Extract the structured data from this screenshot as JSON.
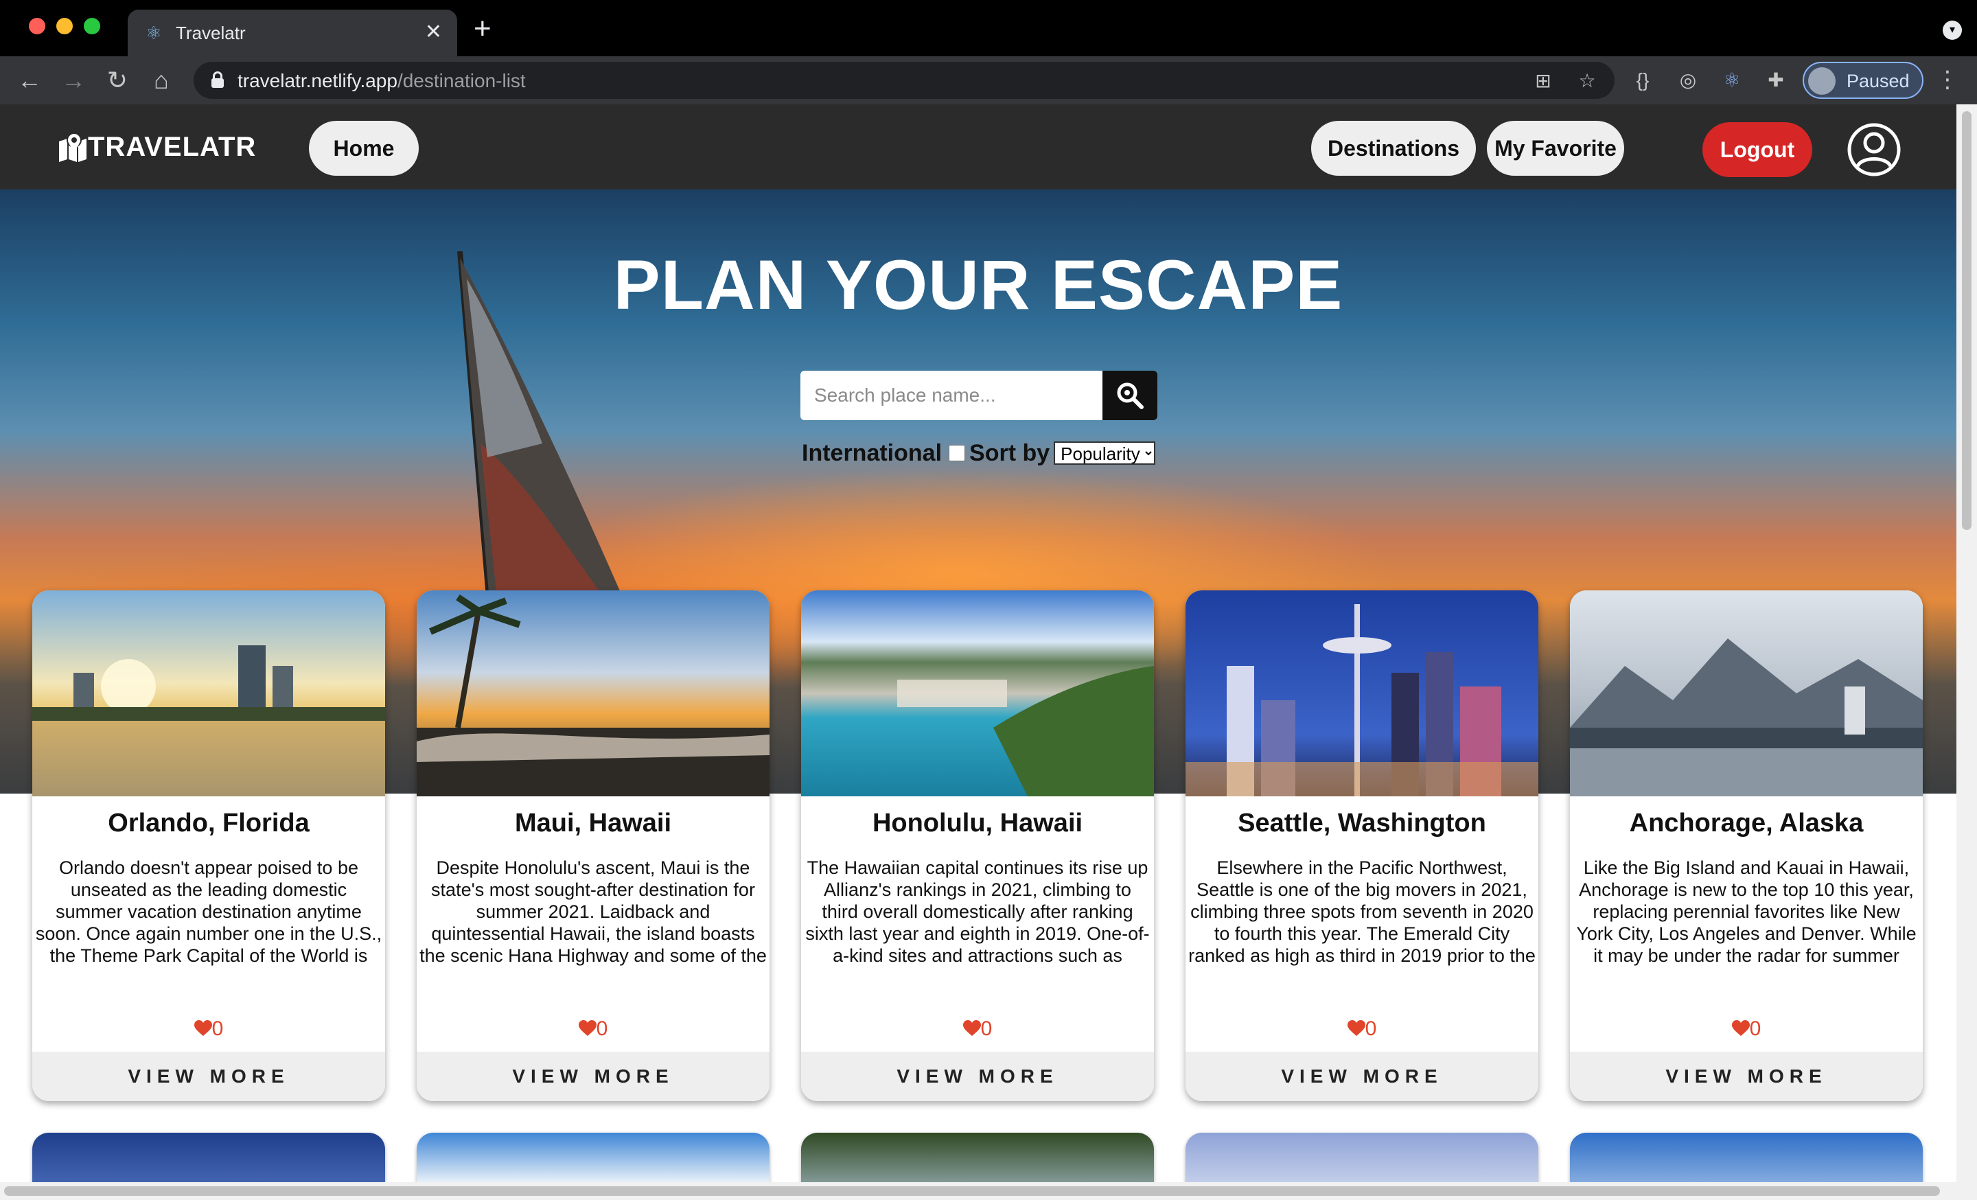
{
  "browser": {
    "tab_title": "Travelatr",
    "url_host": "travelatr.netlify.app",
    "url_path": "/destination-list",
    "profile_label": "Paused"
  },
  "nav": {
    "brand": "TRAVELATR",
    "home": "Home",
    "destinations": "Destinations",
    "favorites": "My Favorite",
    "logout": "Logout"
  },
  "hero": {
    "title": "PLAN YOUR ESCAPE",
    "search_placeholder": "Search place name...",
    "international_label": "International",
    "sort_label": "Sort by",
    "sort_value": "Popularity"
  },
  "cards": [
    {
      "title": "Orlando, Florida",
      "description": "Orlando doesn't appear poised to be unseated as the leading domestic summer vacation destination anytime soon. Once again number one in the U.S., the Theme Park Capital of the World is only building on its allure as it prepares to welcome a",
      "likes": "0",
      "button": "VIEW MORE"
    },
    {
      "title": "Maui, Hawaii",
      "description": "Despite Honolulu's ascent, Maui is the state's most sought-after destination for summer 2021. Laidback and quintessential Hawaii, the island boasts the scenic Hana Highway and some of the most beautiful beaches in the nation.",
      "likes": "0",
      "button": "VIEW MORE"
    },
    {
      "title": "Honolulu, Hawaii",
      "description": "The Hawaiian capital continues its rise up Allianz's rankings in 2021, climbing to third overall domestically after ranking sixth last year and eighth in 2019. One-of-a-kind sites and attractions such as Waikiki Beach and the Pearl Harbor",
      "likes": "0",
      "button": "VIEW MORE"
    },
    {
      "title": "Seattle, Washington",
      "description": "Elsewhere in the Pacific Northwest, Seattle is one of the big movers in 2021, climbing three spots from seventh in 2020 to fourth this year. The Emerald City ranked as high as third in 2019 prior to the coronavirus pandemic and appears well",
      "likes": "0",
      "button": "VIEW MORE"
    },
    {
      "title": "Anchorage, Alaska",
      "description": "Like the Big Island and Kauai in Hawaii, Anchorage is new to the top 10 this year, replacing perennial favorites like New York City, Los Angeles and Denver. While it may be under the radar for summer travel, Alaska's largest city boasts something",
      "likes": "0",
      "button": "VIEW MORE"
    }
  ],
  "colors": {
    "navbar": "#2b2b2b",
    "logout": "#d72626",
    "heart": "#e0452b",
    "card_button": "#eeeeee"
  }
}
